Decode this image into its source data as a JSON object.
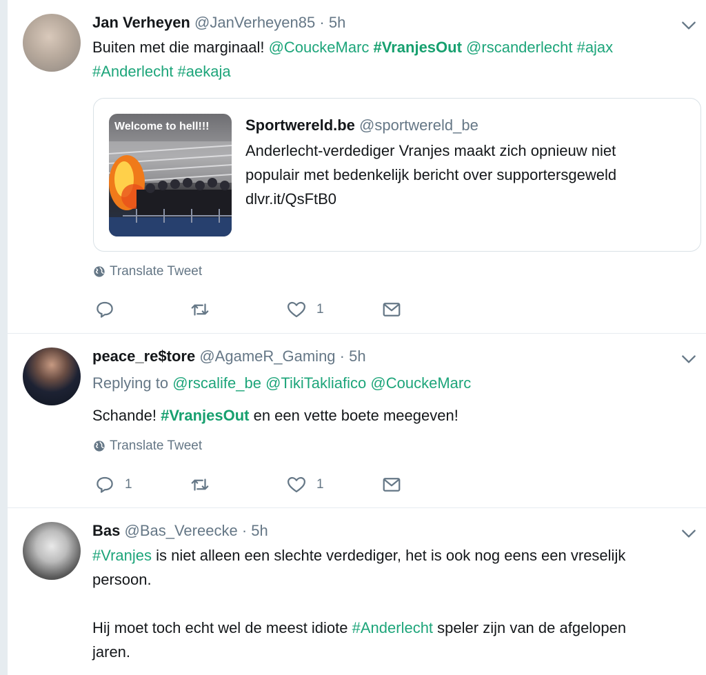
{
  "colors": {
    "accent": "#17a06f",
    "muted": "#657786",
    "border": "#e6ecf0"
  },
  "tweets": [
    {
      "name": "Jan Verheyen",
      "handle": "@JanVerheyen85",
      "sep": "·",
      "time": "5h",
      "text": {
        "prefix": "Buiten met die marginaal! ",
        "m1": "@CouckeMarc",
        "h1": "#VranjesOut",
        "m2": "@rscanderlecht",
        "h2": "#ajax",
        "h3": "#Anderlecht",
        "h4": "#aekaja"
      },
      "quote": {
        "image_caption": "Welcome to hell!!!",
        "name": "Sportwereld.be",
        "handle": "@sportwereld_be",
        "line1": "Anderlecht-verdediger Vranjes maakt zich opnieuw niet",
        "line2": "populair met bedenkelijk bericht over supportersgeweld",
        "line3": "dlvr.it/QsFtB0"
      },
      "translate": "Translate Tweet",
      "actions": {
        "reply_count": "",
        "retweet_count": "",
        "like_count": "1"
      }
    },
    {
      "name": "peace_re$tore",
      "handle": "@AgameR_Gaming",
      "sep": "·",
      "time": "5h",
      "replying_prefix": "Replying to",
      "replying": [
        "@rscalife_be",
        "@TikiTakliafico",
        "@CouckeMarc"
      ],
      "text": {
        "prefix": "Schande! ",
        "h1": "#VranjesOut",
        "suffix": " en een vette boete meegeven!"
      },
      "translate": "Translate Tweet",
      "actions": {
        "reply_count": "1",
        "retweet_count": "",
        "like_count": "1"
      }
    },
    {
      "name": "Bas",
      "handle": "@Bas_Vereecke",
      "sep": "·",
      "time": "5h",
      "text": {
        "h1": "#Vranjes",
        "p1": " is niet alleen een slechte verdediger, het is ook nog eens een vreselijk",
        "p1b": "persoon.",
        "p2a": "Hij moet toch echt wel de meest idiote ",
        "h2": "#Anderlecht",
        "p2b": " speler zijn van de afgelopen",
        "p2c": "jaren."
      }
    }
  ]
}
